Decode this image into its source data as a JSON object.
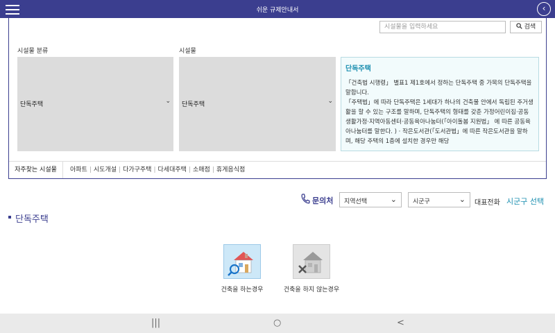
{
  "app": {
    "title": "쉬운 규제안내서"
  },
  "icons": {
    "menu": "hamburger-menu-icon",
    "back": "circle-chevron-left-icon",
    "search": "magnifier-icon",
    "phone": "phone-icon",
    "build": "house-search-icon",
    "no_build": "house-x-icon"
  },
  "colors": {
    "primary": "#3b3e8f",
    "accent": "#1c8fb0"
  },
  "search": {
    "placeholder": "시설물을 입력하세요",
    "button_label": "검색"
  },
  "category": {
    "label": "시설물 분류",
    "selected": "단독주택"
  },
  "facility": {
    "label": "시설물",
    "selected": "단독주택"
  },
  "description": {
    "title": "단독주택",
    "paragraphs": [
      "「건축법 시행령」 별표1 제1호에서 정하는 단독주택 중 가목의 단독주택을 말합니다.",
      "「주택법」에 따라 단독주택은 1세대가 하나의 건축물 안에서 독립된 주거생활을 할 수 있는 구조를 말하며, 단독주택의 형태를 갖춘 가정어린이집·공동생활가정·지역아동센터·공동육아나눔터(「아이돌봄 지원법」 에 따른 공동육아나눔터를 말한다. ) · 작은도서관(「도서관법」에 따른 작은도서관을 말하며, 해당 주택의 1층에 설치한 경우만 해당"
    ]
  },
  "frequent": {
    "label": "자주찾는 시설물",
    "items": [
      "아파트",
      "시도개설",
      "다가구주택",
      "다세대주택",
      "소매점",
      "휴게음식점"
    ]
  },
  "contact": {
    "label": "문의처",
    "region_select": "지역선택",
    "district_select": "시군구",
    "rep_phone_label": "대표전화",
    "rep_phone_value": "시군구 선택"
  },
  "section": {
    "title": "단독주택"
  },
  "options": {
    "build": "건축을 하는경우",
    "no_build": "건축을 하지 않는경우"
  },
  "navbar": {
    "recent": "|||",
    "home": "○",
    "back": "<"
  }
}
